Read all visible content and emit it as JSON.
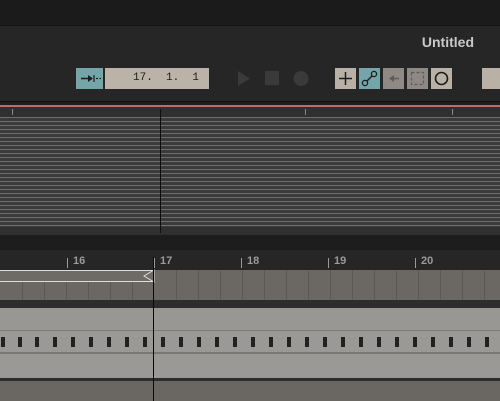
{
  "window": {
    "title": "Untitled"
  },
  "toolbar": {
    "follow_icon": "follow-arrow-icon",
    "position": "17.  1.  1",
    "colors": {
      "active": "#74a5a8",
      "inactive": "#b9b1a6",
      "disabled": "#8e8985"
    },
    "buttons": [
      "play-icon",
      "stop-icon",
      "record-icon",
      "draw-mode-icon",
      "automation-icon",
      "back-to-arrangement-icon",
      "loop-icon",
      "punch-icon"
    ]
  },
  "ruler": {
    "bars": [
      "16",
      "17",
      "18",
      "19",
      "20"
    ]
  },
  "colors": {
    "overview_border": "#c26a6a"
  }
}
